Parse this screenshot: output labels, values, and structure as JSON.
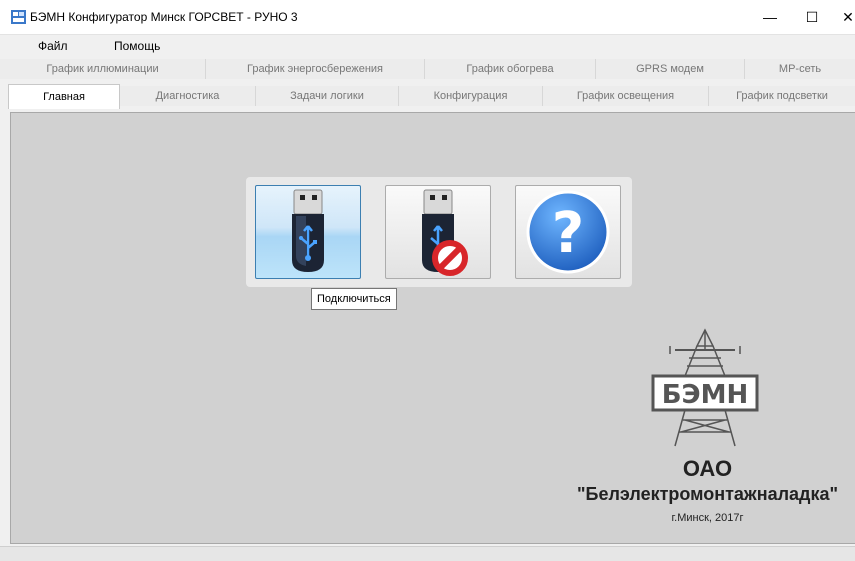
{
  "window": {
    "title": "БЭМН Конфигуратор Минск ГОРСВЕТ - РУНО 3",
    "minimize": "—",
    "maximize": "☐",
    "close": "✕"
  },
  "menu": {
    "file": "Файл",
    "help": "Помощь"
  },
  "tabs_top": [
    "График иллюминации",
    "График энергосбережения",
    "График обогрева",
    "GPRS модем",
    "МР-сеть"
  ],
  "tabs_bottom": [
    "Главная",
    "Диагностика",
    "Задачи логики",
    "Конфигурация",
    "График освещения",
    "График подсветки"
  ],
  "active_tab": "Главная",
  "main": {
    "tooltip": "Подключиться",
    "buttons": {
      "connect_icon": "usb-drive-icon",
      "disconnect_icon": "usb-drive-blocked-icon",
      "help_icon": "question-mark-icon"
    }
  },
  "branding": {
    "logo_text": "БЭМН",
    "org_type": "ОАО",
    "org_name": "\"Белэлектромонтажналадка\"",
    "place": "г.Минск, 2017г"
  },
  "colors": {
    "accent_blue": "#2a6fc9",
    "content_bg": "#d1d1d1"
  }
}
